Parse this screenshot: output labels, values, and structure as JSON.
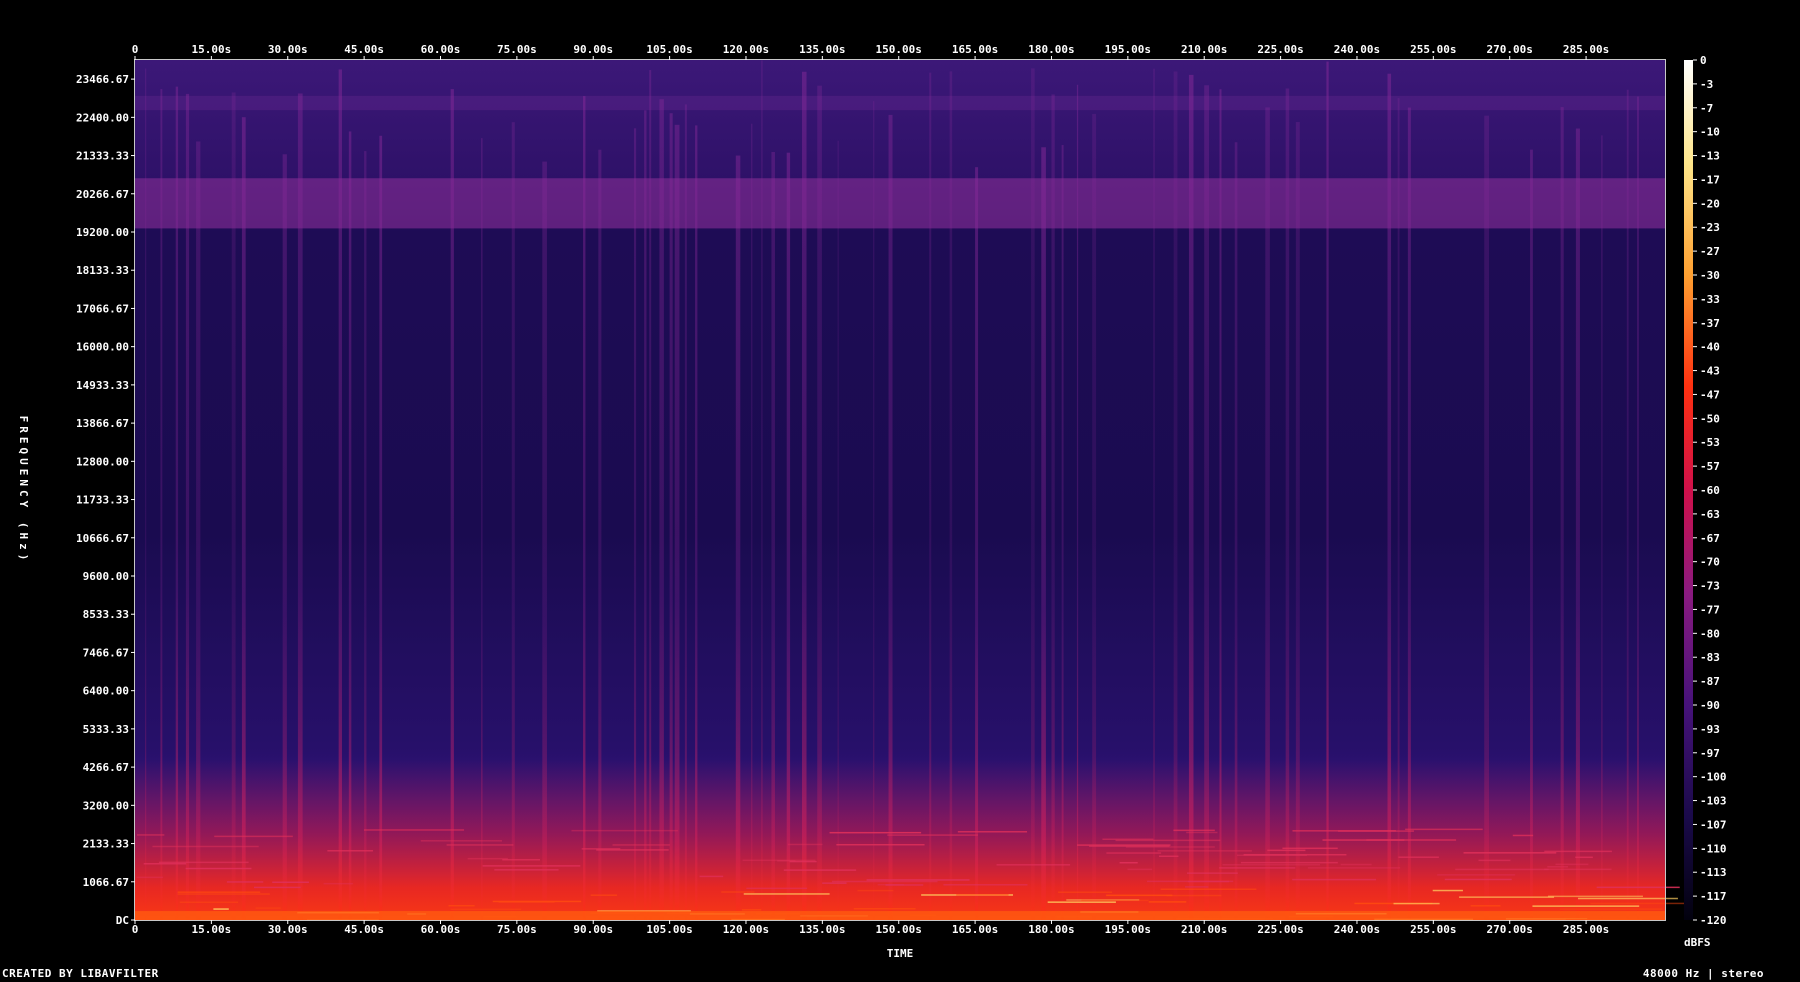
{
  "chart_data": {
    "type": "heatmap",
    "title": "",
    "xlabel": "TIME",
    "ylabel": "FREQUENCY (Hz)",
    "x_unit": "s",
    "x_ticks": [
      0,
      15,
      30,
      45,
      60,
      75,
      90,
      105,
      120,
      135,
      150,
      165,
      180,
      195,
      210,
      225,
      240,
      255,
      270,
      285
    ],
    "x_tick_labels": [
      "0",
      "15.00s",
      "30.00s",
      "45.00s",
      "60.00s",
      "75.00s",
      "90.00s",
      "105.00s",
      "120.00s",
      "135.00s",
      "150.00s",
      "165.00s",
      "180.00s",
      "195.00s",
      "210.00s",
      "225.00s",
      "240.00s",
      "255.00s",
      "270.00s",
      "285.00s"
    ],
    "xlim": [
      0,
      300.5
    ],
    "y_ticks": [
      0,
      1066.67,
      2133.33,
      3200.0,
      4266.67,
      5333.33,
      6400.0,
      7466.67,
      8533.33,
      9600.0,
      10666.67,
      11733.33,
      12800.0,
      13866.67,
      14933.33,
      16000.0,
      17066.67,
      18133.33,
      19200.0,
      20266.67,
      21333.33,
      22400.0,
      23466.67
    ],
    "y_tick_labels": [
      "DC",
      "1066.67",
      "2133.33",
      "3200.00",
      "4266.67",
      "5333.33",
      "6400.00",
      "7466.67",
      "8533.33",
      "9600.00",
      "10666.67",
      "11733.33",
      "12800.00",
      "13866.67",
      "14933.33",
      "16000.00",
      "17066.67",
      "18133.33",
      "19200.00",
      "20266.67",
      "21333.33",
      "22400.00",
      "23466.67"
    ],
    "ylim": [
      0,
      24000
    ],
    "colorbar": {
      "label": "dBFS",
      "range": [
        -120,
        0
      ],
      "tick_labels": [
        "0",
        "-3",
        "-7",
        "-10",
        "-13",
        "-17",
        "-20",
        "-23",
        "-27",
        "-30",
        "-33",
        "-37",
        "-40",
        "-43",
        "-47",
        "-50",
        "-53",
        "-57",
        "-60",
        "-63",
        "-67",
        "-70",
        "-73",
        "-77",
        "-80",
        "-83",
        "-87",
        "-90",
        "-93",
        "-97",
        "-100",
        "-103",
        "-107",
        "-110",
        "-113",
        "-117",
        "-120"
      ]
    },
    "colors": {
      "background": "#000000",
      "low": "#04021e",
      "mid_low": "#2a0c6e",
      "mid": "#6a1a8c",
      "mid_high": "#c02060",
      "high": "#ff2a10",
      "top": "#ffd060",
      "peak": "#ffffff"
    },
    "grid": false
  },
  "footer": {
    "credit": "CREATED BY LIBAVFILTER",
    "info": "48000 Hz | stereo"
  }
}
